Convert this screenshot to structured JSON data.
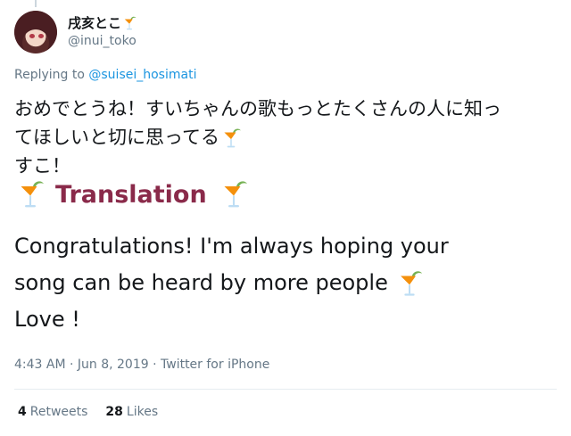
{
  "tweet": {
    "display_name": "戌亥とこ",
    "handle": "@inui_toko",
    "replying_prefix": "Replying to",
    "replying_to": "@suisei_hosimati",
    "jp_line1": "おめでとうね！すいちゃんの歌もっとたくさんの人に知っ",
    "jp_line2": "てほしいと切に思ってる",
    "jp_line3": "すこ！",
    "timestamp": "4:43 AM · Jun 8, 2019 · Twitter for iPhone",
    "retweets_count": "4",
    "retweets_label": "Retweets",
    "likes_count": "28",
    "likes_label": "Likes"
  },
  "translation": {
    "label": "Translation",
    "line1": "Congratulations! I'm always hoping your",
    "line2": "song can be heard by more people",
    "line3": "Love !"
  },
  "icons": {
    "emoji": "tropical-drink-icon",
    "accent": "#8a2a4a",
    "mention_color": "#1b95e0"
  }
}
